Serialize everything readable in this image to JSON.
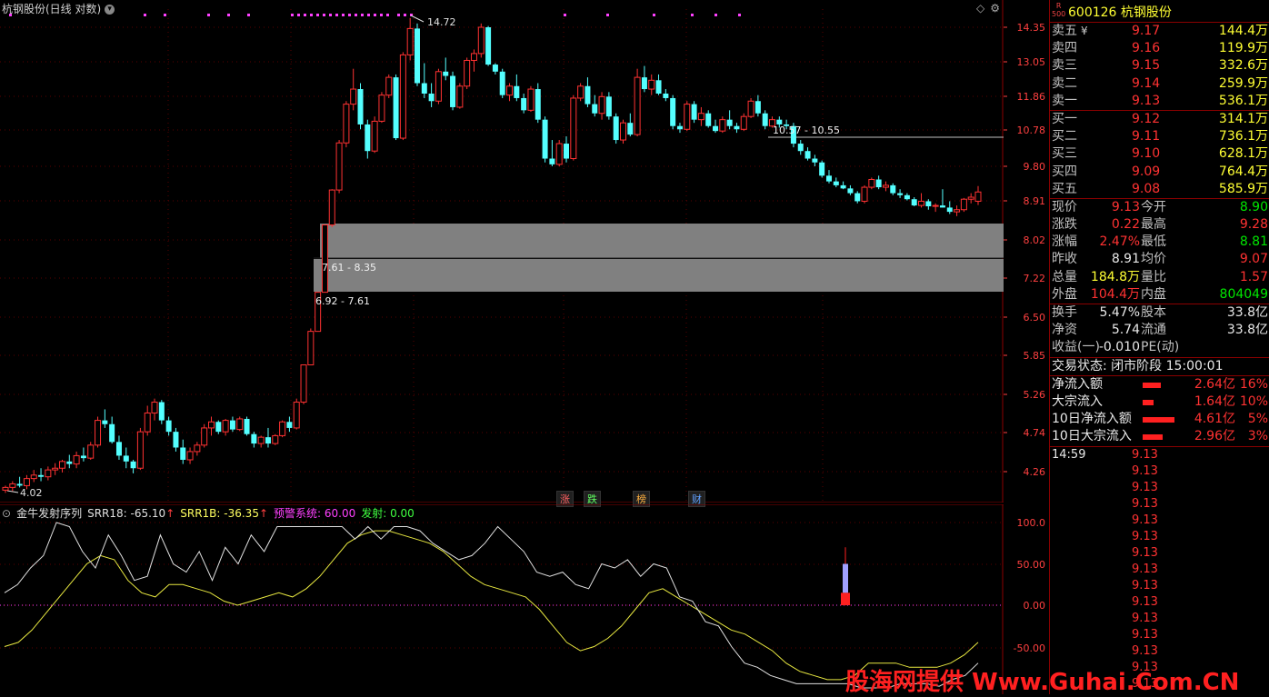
{
  "header": {
    "title": "杭钢股份(日线 对数)",
    "dropdown_glyph": "▾"
  },
  "main_chart": {
    "price_labels": [
      "14.35",
      "13.05",
      "11.86",
      "10.78",
      "9.80",
      "8.91",
      "8.02",
      "7.22",
      "6.50",
      "5.85",
      "5.26",
      "4.74",
      "4.26"
    ],
    "annotations": {
      "high": "14.72",
      "low": "4.02",
      "gap_upper": "7.61 - 8.35",
      "gap_lower": "6.92 - 7.61",
      "line_label": "10.57 - 10.55"
    },
    "event_tags": [
      {
        "text": "涨",
        "color": "#ff6060"
      },
      {
        "text": "跌",
        "color": "#60ff60"
      },
      {
        "text": "榜",
        "color": "#ffb040"
      },
      {
        "text": "财",
        "color": "#60a0ff"
      }
    ]
  },
  "indicator": {
    "name": "金牛发射序列",
    "srr18": "SRR18: -65.10",
    "srr1b": "SRR1B: -36.35",
    "alarm": "预警系统: 60.00",
    "launch": "发射: 0.00",
    "arrow": "↑",
    "axis_labels": [
      "100.0",
      "50.00",
      "0.00",
      "-50.00"
    ]
  },
  "panel": {
    "r_label": "R",
    "r_sub": "500",
    "stock_code_name": "600126 杭钢股份",
    "asks": [
      {
        "label": "卖五",
        "mark": "¥",
        "price": "9.17",
        "vol": "144.4万"
      },
      {
        "label": "卖四",
        "mark": "",
        "price": "9.16",
        "vol": "119.9万"
      },
      {
        "label": "卖三",
        "mark": "",
        "price": "9.15",
        "vol": "332.6万"
      },
      {
        "label": "卖二",
        "mark": "",
        "price": "9.14",
        "vol": "259.9万"
      },
      {
        "label": "卖一",
        "mark": "",
        "price": "9.13",
        "vol": "536.1万"
      }
    ],
    "bids": [
      {
        "label": "买一",
        "price": "9.12",
        "vol": "314.1万"
      },
      {
        "label": "买二",
        "price": "9.11",
        "vol": "736.1万"
      },
      {
        "label": "买三",
        "price": "9.10",
        "vol": "628.1万"
      },
      {
        "label": "买四",
        "price": "9.09",
        "vol": "764.4万"
      },
      {
        "label": "买五",
        "price": "9.08",
        "vol": "585.9万"
      }
    ],
    "stats": [
      {
        "l1": "现价",
        "v1": "9.13",
        "c1": "red",
        "l2": "今开",
        "v2": "8.90",
        "c2": "green"
      },
      {
        "l1": "涨跌",
        "v1": "0.22",
        "c1": "red",
        "l2": "最高",
        "v2": "9.28",
        "c2": "red"
      },
      {
        "l1": "涨幅",
        "v1": "2.47%",
        "c1": "red",
        "l2": "最低",
        "v2": "8.81",
        "c2": "green"
      },
      {
        "l1": "昨收",
        "v1": "8.91",
        "c1": "white",
        "l2": "均价",
        "v2": "9.07",
        "c2": "red"
      },
      {
        "l1": "总量",
        "v1": "184.8万",
        "c1": "yellow",
        "l2": "量比",
        "v2": "1.57",
        "c2": "red"
      },
      {
        "l1": "外盘",
        "v1": "104.4万",
        "c1": "red",
        "l2": "内盘",
        "v2": "804049",
        "c2": "green"
      }
    ],
    "stats2": [
      {
        "l1": "换手",
        "v1": "5.47%",
        "l2": "股本",
        "v2": "33.8亿"
      },
      {
        "l1": "净资",
        "v1": "5.74",
        "l2": "流通",
        "v2": "33.8亿"
      },
      {
        "l1": "收益(一)",
        "v1": "-0.010",
        "l2": "PE(动)",
        "v2": ""
      }
    ],
    "trade_status": "交易状态: 闭市阶段 15:00:01",
    "flows": [
      {
        "label": "净流入额",
        "amount": "2.64亿",
        "pct": "16%",
        "bar": 0.35
      },
      {
        "label": "大宗流入",
        "amount": "1.64亿",
        "pct": "10%",
        "bar": 0.22
      },
      {
        "label": "10日净流入额",
        "amount": "4.61亿",
        "pct": "5%",
        "bar": 0.62
      },
      {
        "label": "10日大宗流入",
        "amount": "2.96亿",
        "pct": "3%",
        "bar": 0.4
      }
    ],
    "tick_time": "14:59",
    "tick_prices": [
      "9.13",
      "9.13",
      "9.13",
      "9.13",
      "9.13",
      "9.13",
      "9.13",
      "9.13",
      "9.13",
      "9.13",
      "9.13",
      "9.13",
      "9.13",
      "9.13",
      "9.13"
    ]
  },
  "watermark": "股海网提供 Www.Guhai.Com.CN",
  "colors": {
    "up": "#ff3232",
    "down": "#54ffff",
    "grid": "#8b0000",
    "gap_fill": "#808080"
  }
}
